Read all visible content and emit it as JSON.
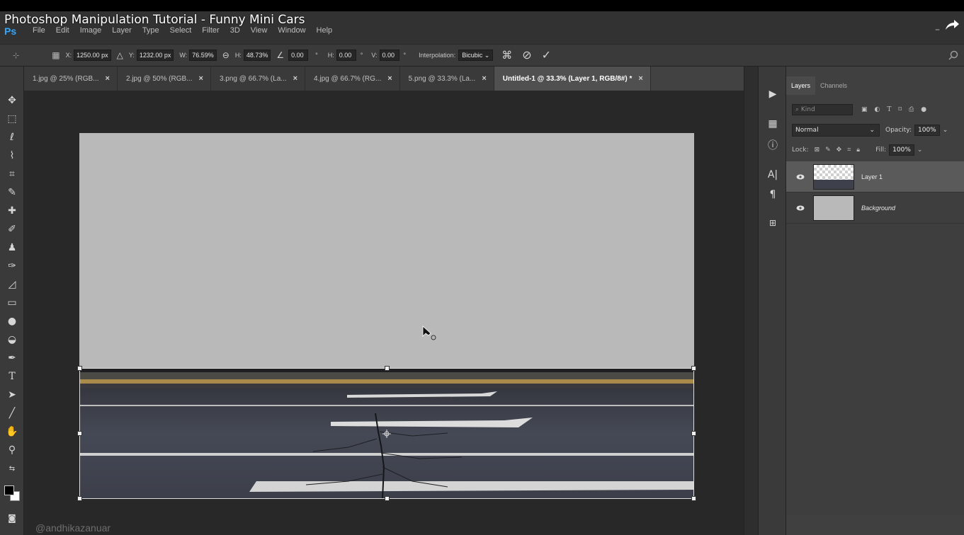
{
  "video_title": "Photoshop Manipulation Tutorial - Funny Mini Cars",
  "app": {
    "logo": "Ps"
  },
  "menu": [
    "File",
    "Edit",
    "Image",
    "Layer",
    "Type",
    "Select",
    "Filter",
    "3D",
    "View",
    "Window",
    "Help"
  ],
  "options": {
    "x_label": "X:",
    "x_value": "1250.00 px",
    "y_label": "Y:",
    "y_value": "1232.00 px",
    "w_label": "W:",
    "w_value": "76.59%",
    "h_label": "H:",
    "h_value": "48.73%",
    "angle_value": "0.00",
    "angle_unit": "°",
    "hskew_label": "H:",
    "hskew_value": "0.00",
    "vskew_label": "V:",
    "vskew_value": "0.00",
    "interp_label": "Interpolation:",
    "interp_value": "Bicubic"
  },
  "tabs": [
    {
      "label": "1.jpg @ 25% (RGB...",
      "active": false
    },
    {
      "label": "2.jpg @ 50% (RGB...",
      "active": false
    },
    {
      "label": "3.png @ 66.7% (La...",
      "active": false
    },
    {
      "label": "4.jpg @ 66.7% (RG...",
      "active": false
    },
    {
      "label": "5.png @ 33.3% (La...",
      "active": false
    },
    {
      "label": "Untitled-1 @ 33.3% (Layer 1, RGB/8#) *",
      "active": true
    }
  ],
  "tab_close": "×",
  "layers_panel": {
    "tabs": [
      "Layers",
      "Channels"
    ],
    "filter_placeholder": "Kind",
    "blend_mode": "Normal",
    "opacity_label": "Opacity:",
    "opacity_value": "100%",
    "lock_label": "Lock:",
    "fill_label": "Fill:",
    "fill_value": "100%",
    "layers": [
      {
        "name": "Layer 1",
        "selected": true,
        "visible": true
      },
      {
        "name": "Background",
        "selected": false,
        "visible": true
      }
    ]
  },
  "watermark": "@andhikazanuar",
  "colors": {
    "accent_ps": "#31a8ff",
    "canvas_bg": "#b9b9b9",
    "road": "#3b3e48",
    "selected_layer": "#5a5a5a"
  },
  "icons": [
    "share-icon",
    "search-icon",
    "warp-icon",
    "cancel-icon",
    "commit-icon",
    "eye-icon"
  ]
}
